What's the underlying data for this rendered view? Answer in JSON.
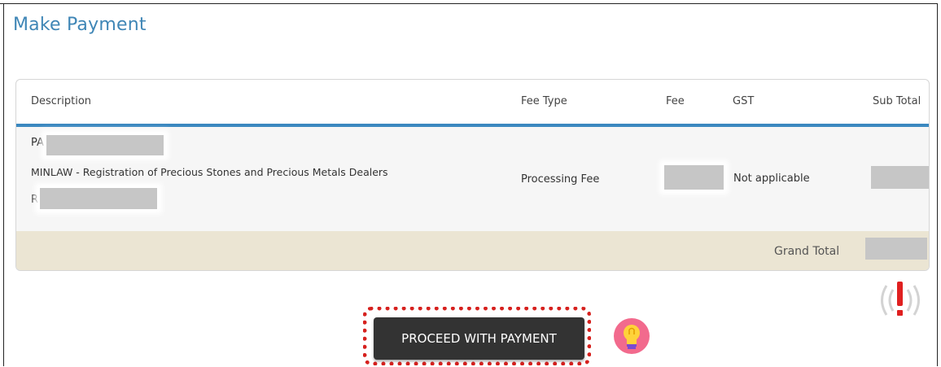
{
  "page": {
    "title": "Make Payment"
  },
  "table": {
    "columns": {
      "description": "Description",
      "fee_type": "Fee Type",
      "fee": "Fee",
      "gst": "GST",
      "sub_total": "Sub Total"
    },
    "rows": [
      {
        "line1_prefix": "PA",
        "service": "MINLAW - Registration of Precious Stones and Precious Metals Dealers",
        "line3_prefix": "R",
        "fee_type": "Processing Fee",
        "gst": "Not applicable"
      }
    ],
    "footer": {
      "grand_total_label": "Grand Total"
    }
  },
  "actions": {
    "proceed_label": "PROCEED WITH PAYMENT"
  },
  "icons": {
    "hint": "lightbulb-icon",
    "alert": "alert-signal-icon"
  },
  "colors": {
    "title": "#3f86b6",
    "header_rule": "#3b88c0",
    "total_row_bg": "#ebe5d3",
    "button_bg": "#333333",
    "highlight": "#d6211e",
    "bulb_bg": "#f26a8d"
  }
}
